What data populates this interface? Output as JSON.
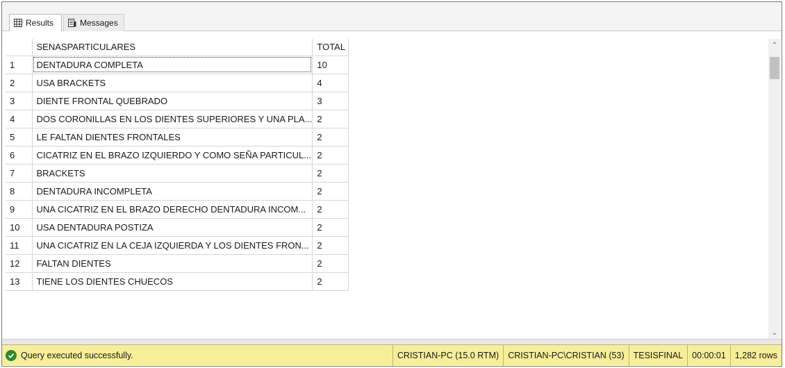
{
  "tabs": [
    {
      "label": "Results",
      "icon": "grid-icon",
      "active": true
    },
    {
      "label": "Messages",
      "icon": "messages-icon",
      "active": false
    }
  ],
  "grid": {
    "columns": [
      "",
      "SENASPARTICULARES",
      "TOTAL"
    ],
    "rows": [
      [
        "1",
        "DENTADURA COMPLETA",
        "10"
      ],
      [
        "2",
        "USA BRACKETS",
        "4"
      ],
      [
        "3",
        "DIENTE FRONTAL QUEBRADO",
        "3"
      ],
      [
        "4",
        "DOS CORONILLAS EN LOS DIENTES SUPERIORES Y UNA PLA...",
        "2"
      ],
      [
        "5",
        "LE FALTAN DIENTES FRONTALES",
        "2"
      ],
      [
        "6",
        "CICATRIZ EN EL BRAZO IZQUIERDO Y COMO SEÑA PARTICUL...",
        "2"
      ],
      [
        "7",
        "BRACKETS",
        "2"
      ],
      [
        "8",
        "DENTADURA INCOMPLETA",
        "2"
      ],
      [
        "9",
        "UNA CICATRIZ EN EL BRAZO DERECHO DENTADURA INCOM...",
        "2"
      ],
      [
        "10",
        "USA DENTADURA POSTIZA",
        "2"
      ],
      [
        "11",
        "UNA CICATRIZ EN LA CEJA IZQUIERDA Y LOS DIENTES FRON...",
        "2"
      ],
      [
        "12",
        "FALTAN DIENTES",
        "2"
      ],
      [
        "13",
        "TIENE LOS DIENTES CHUECOS",
        "2"
      ]
    ]
  },
  "status": {
    "message": "Query executed successfully.",
    "server": "CRISTIAN-PC (15.0 RTM)",
    "user": "CRISTIAN-PC\\CRISTIAN (53)",
    "database": "TESISFINAL",
    "elapsed": "00:00:01",
    "rows": "1,282 rows",
    "bar_color": "#f7ee99",
    "ok_color": "#2e8b2e"
  }
}
